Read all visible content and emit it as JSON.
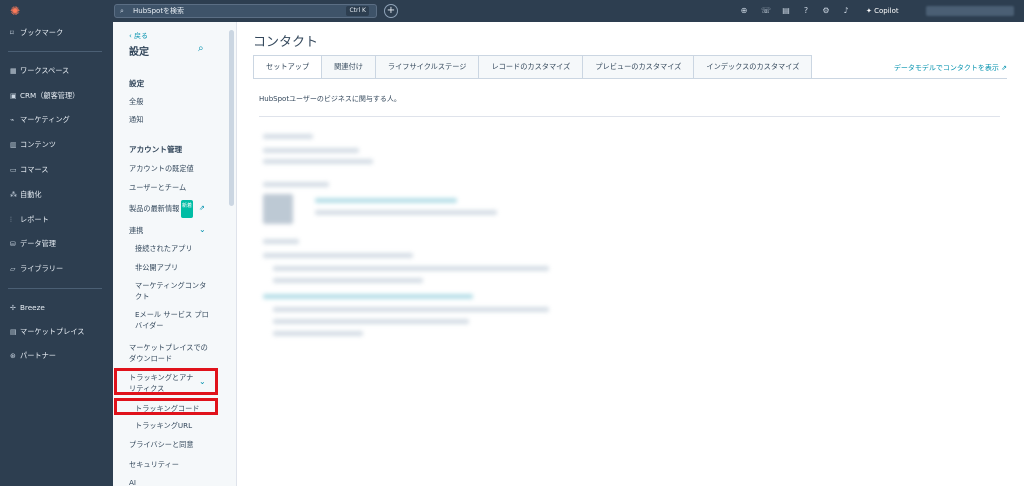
{
  "topbar": {
    "search_placeholder": "HubSpotを検索",
    "shortcut": "Ctrl K",
    "copilot": "Copilot"
  },
  "nav": {
    "items": [
      {
        "label": "ブックマーク",
        "icon": "bookmark-icon"
      },
      {
        "label": "ワークスペース",
        "icon": "workspace-icon"
      },
      {
        "label": "CRM（顧客管理）",
        "icon": "crm-icon"
      },
      {
        "label": "マーケティング",
        "icon": "marketing-icon"
      },
      {
        "label": "コンテンツ",
        "icon": "content-icon"
      },
      {
        "label": "コマース",
        "icon": "commerce-icon"
      },
      {
        "label": "自動化",
        "icon": "automation-icon"
      },
      {
        "label": "レポート",
        "icon": "report-icon"
      },
      {
        "label": "データ管理",
        "icon": "data-icon"
      },
      {
        "label": "ライブラリー",
        "icon": "library-icon"
      },
      {
        "label": "Breeze",
        "icon": "breeze-icon"
      },
      {
        "label": "マーケットプレイス",
        "icon": "marketplace-icon"
      },
      {
        "label": "パートナー",
        "icon": "partner-icon"
      }
    ]
  },
  "settings": {
    "back": "戻る",
    "title": "設定",
    "section_settings": "設定",
    "general": "全般",
    "notifications": "通知",
    "section_account": "アカウント管理",
    "account_defaults": "アカウントの既定値",
    "users_teams": "ユーザーとチーム",
    "product_updates": "製品の最新情報",
    "new_badge": "新着",
    "integrations": "連携",
    "connected_apps": "接続されたアプリ",
    "private_apps": "非公開アプリ",
    "marketing_contacts_1": "マーケティングコンタ",
    "marketing_contacts_2": "クト",
    "email_provider_1": "Eメール サービス プロ",
    "email_provider_2": "バイダー",
    "marketplace_dl_1": "マーケットプレイスでの",
    "marketplace_dl_2": "ダウンロード",
    "tracking_analytics_1": "トラッキングとアナ",
    "tracking_analytics_2": "リティクス",
    "tracking_code": "トラッキングコード",
    "tracking_url": "トラッキングURL",
    "privacy": "プライバシーと同意",
    "security": "セキュリティー",
    "ai": "AI"
  },
  "main": {
    "title": "コンタクト",
    "tabs": [
      {
        "label": "セットアップ"
      },
      {
        "label": "関連付け"
      },
      {
        "label": "ライフサイクルステージ"
      },
      {
        "label": "レコードのカスタマイズ"
      },
      {
        "label": "プレビューのカスタマイズ"
      },
      {
        "label": "インデックスのカスタマイズ"
      }
    ],
    "data_model_link": "データモデルでコンタクトを表示",
    "description": "HubSpotユーザーのビジネスに関与する人。"
  },
  "colors": {
    "nav_bg": "#2d3e50",
    "accent": "#0091ae",
    "highlight": "#e0121b",
    "badge": "#00bda5"
  }
}
